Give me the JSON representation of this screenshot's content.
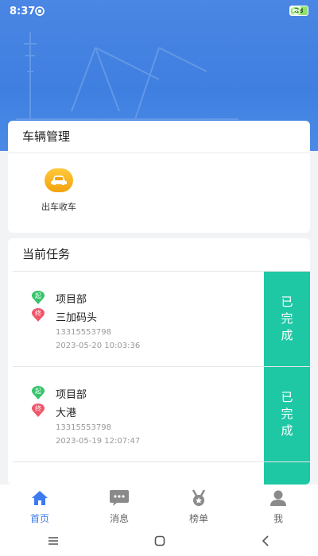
{
  "status_bar": {
    "time": "8:37",
    "battery": "88"
  },
  "vehicle_management": {
    "title": "车辆管理",
    "items": [
      {
        "label": "出车收车",
        "icon": "car-icon"
      }
    ]
  },
  "current_tasks": {
    "title": "当前任务",
    "tasks": [
      {
        "start_badge": "起",
        "end_badge": "终",
        "start": "项目部",
        "end": "三加码头",
        "phone": "13315553798",
        "datetime": "2023-05-20 10:03:36",
        "status_chars": [
          "已",
          "完",
          "成"
        ]
      },
      {
        "start_badge": "起",
        "end_badge": "终",
        "start": "项目部",
        "end": "大港",
        "phone": "13315553798",
        "datetime": "2023-05-19 12:07:47",
        "status_chars": [
          "已",
          "完",
          "成"
        ]
      }
    ]
  },
  "tabs": [
    {
      "label": "首页",
      "icon": "home-icon",
      "active": true
    },
    {
      "label": "消息",
      "icon": "message-icon",
      "active": false
    },
    {
      "label": "榜单",
      "icon": "medal-icon",
      "active": false
    },
    {
      "label": "我",
      "icon": "user-icon",
      "active": false
    }
  ],
  "colors": {
    "primary": "#3d7cf0",
    "done": "#1ec8a5",
    "start_pin": "#35c46a",
    "end_pin": "#f0566a",
    "car": "#f6a616"
  }
}
